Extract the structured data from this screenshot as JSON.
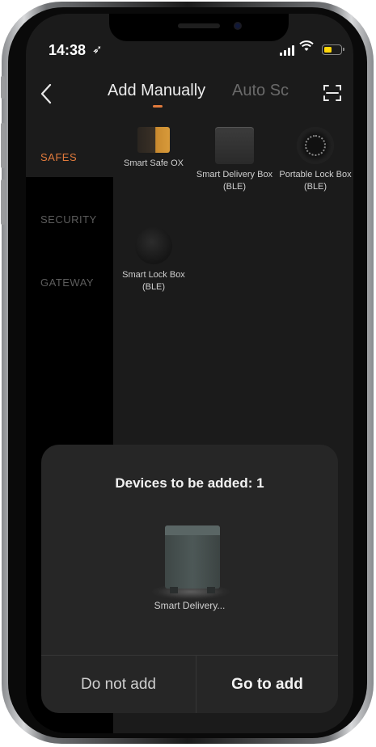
{
  "status_bar": {
    "time": "14:38",
    "location_icon": "location-arrow-icon",
    "wifi_icon": "wifi-icon",
    "battery_color": "#ffd60a"
  },
  "nav": {
    "back_icon": "chevron-left-icon",
    "tab_active": "Add Manually",
    "tab_inactive": "Auto Sc",
    "scan_icon": "scan-frame-icon",
    "accent": "#e07a3c"
  },
  "sidebar": {
    "items": [
      {
        "label": "SAFES",
        "active": true
      },
      {
        "label": "SECURITY",
        "active": false
      },
      {
        "label": "GATEWAY",
        "active": false
      }
    ]
  },
  "devices": [
    {
      "label": "Smart Safe OX",
      "icon": "smart-safe-icon"
    },
    {
      "label": "Smart Delivery Box (BLE)",
      "icon": "delivery-box-icon"
    },
    {
      "label": "Portable Lock Box (BLE)",
      "icon": "portable-lock-box-icon"
    },
    {
      "label": "Smart Lock Box (BLE)",
      "icon": "smart-lock-box-icon"
    }
  ],
  "sheet": {
    "title": "Devices to be added: 1",
    "device_label": "Smart Delivery...",
    "cancel_label": "Do not add",
    "confirm_label": "Go to add"
  }
}
